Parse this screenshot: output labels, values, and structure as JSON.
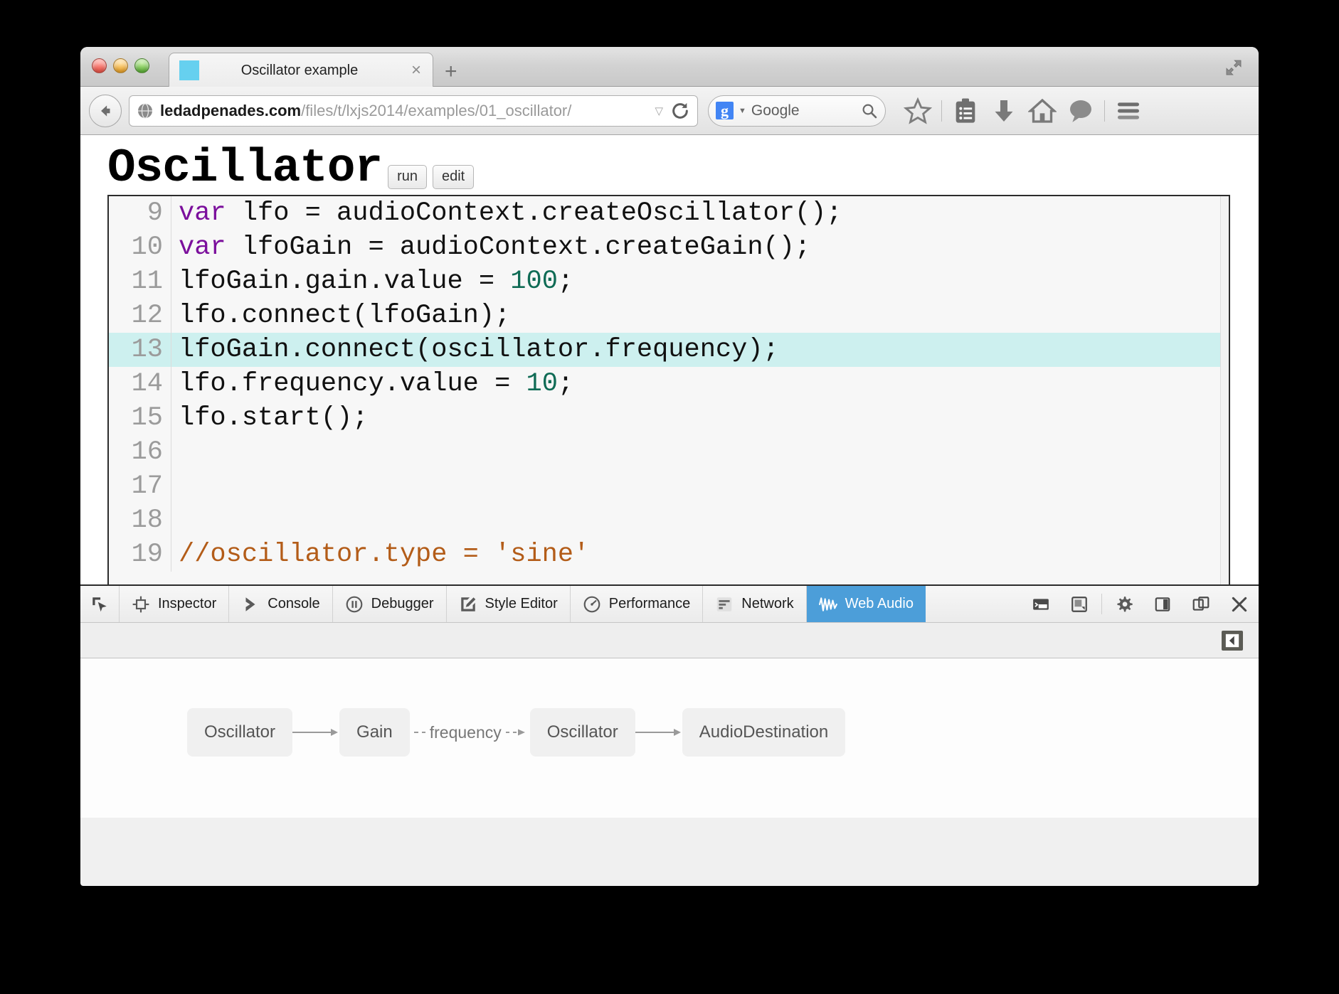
{
  "window": {
    "traffic_lights": [
      "close",
      "minimize",
      "zoom"
    ],
    "expand_icon": "expand-arrows-icon"
  },
  "tab": {
    "title": "Oscillator example",
    "close_label": "×",
    "new_tab_label": "+"
  },
  "navbar": {
    "back_icon": "back-arrow-icon",
    "url_host": "ledadpenades.com",
    "url_path": "/files/t/lxjs2014/examples/01_oscillator/",
    "url_dropdown": "▽",
    "reload_icon": "reload-icon",
    "search_engine_badge": "g",
    "search_placeholder": "Google",
    "icons": [
      "bookmark-star-icon",
      "reading-list-icon",
      "downloads-icon",
      "home-icon",
      "chat-icon",
      "hamburger-menu-icon"
    ]
  },
  "page": {
    "title": "Oscillator",
    "run_label": "run",
    "edit_label": "edit",
    "editor": {
      "highlighted_line": 13,
      "lines": [
        {
          "num": "9",
          "tokens": [
            {
              "t": "var",
              "c": "kw"
            },
            {
              "t": " lfo = audioContext.createOscillator();",
              "c": ""
            }
          ]
        },
        {
          "num": "10",
          "tokens": [
            {
              "t": "var",
              "c": "kw"
            },
            {
              "t": " lfoGain = audioContext.createGain();",
              "c": ""
            }
          ]
        },
        {
          "num": "11",
          "tokens": [
            {
              "t": "lfoGain.gain.value = ",
              "c": ""
            },
            {
              "t": "100",
              "c": "num"
            },
            {
              "t": ";",
              "c": ""
            }
          ]
        },
        {
          "num": "12",
          "tokens": [
            {
              "t": "lfo.connect(lfoGain);",
              "c": ""
            }
          ]
        },
        {
          "num": "13",
          "tokens": [
            {
              "t": "lfoGain.connect(oscillator.frequency);",
              "c": ""
            }
          ]
        },
        {
          "num": "14",
          "tokens": [
            {
              "t": "lfo.frequency.value = ",
              "c": ""
            },
            {
              "t": "10",
              "c": "num"
            },
            {
              "t": ";",
              "c": ""
            }
          ]
        },
        {
          "num": "15",
          "tokens": [
            {
              "t": "lfo.start();",
              "c": ""
            }
          ]
        },
        {
          "num": "16",
          "tokens": [
            {
              "t": "",
              "c": ""
            }
          ]
        },
        {
          "num": "17",
          "tokens": [
            {
              "t": "",
              "c": ""
            }
          ]
        },
        {
          "num": "18",
          "tokens": [
            {
              "t": "",
              "c": ""
            }
          ]
        },
        {
          "num": "19",
          "tokens": [
            {
              "t": "//oscillator.type = 'sine'",
              "c": "cmt"
            }
          ]
        }
      ]
    }
  },
  "devtools": {
    "picker_icon": "element-picker-icon",
    "tabs": [
      {
        "label": "Inspector",
        "icon": "inspector-icon",
        "active": false
      },
      {
        "label": "Console",
        "icon": "console-icon",
        "active": false
      },
      {
        "label": "Debugger",
        "icon": "debugger-icon",
        "active": false
      },
      {
        "label": "Style Editor",
        "icon": "style-editor-icon",
        "active": false
      },
      {
        "label": "Performance",
        "icon": "performance-icon",
        "active": false
      },
      {
        "label": "Network",
        "icon": "network-icon",
        "active": false
      },
      {
        "label": "Web Audio",
        "icon": "web-audio-icon",
        "active": true
      }
    ],
    "right_buttons": [
      "split-console-icon",
      "responsive-design-icon",
      "settings-gear-icon",
      "dock-side-icon",
      "dock-window-icon",
      "close-devtools-icon"
    ],
    "sidebar_toggle_icon": "sidebar-expand-icon",
    "accent_color": "#4c9ed9"
  },
  "graph": {
    "nodes": [
      {
        "label": "Oscillator"
      },
      {
        "label": "Gain"
      },
      {
        "label": "Oscillator"
      },
      {
        "label": "AudioDestination"
      }
    ],
    "param_edge_label": "frequency"
  }
}
